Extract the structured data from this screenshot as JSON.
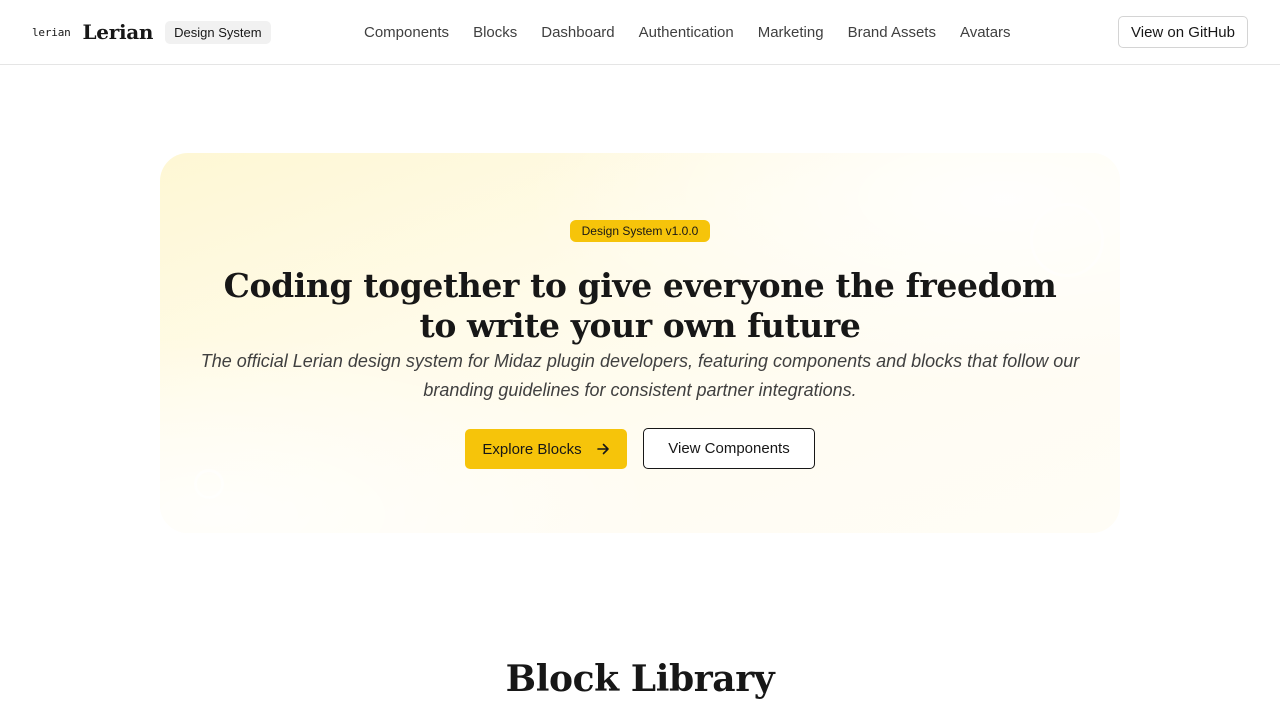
{
  "header": {
    "logo_mark": "lerian",
    "brand_name": "Lerian",
    "brand_badge": "Design System",
    "nav": [
      {
        "label": "Components"
      },
      {
        "label": "Blocks"
      },
      {
        "label": "Dashboard"
      },
      {
        "label": "Authentication"
      },
      {
        "label": "Marketing"
      },
      {
        "label": "Brand Assets"
      },
      {
        "label": "Avatars"
      }
    ],
    "github_label": "View on GitHub"
  },
  "hero": {
    "badge": "Design System v1.0.0",
    "title": "Coding together to give everyone the freedom to write your own future",
    "subtitle": "The official Lerian design system for Midaz plugin developers, featuring components and blocks that follow our branding guidelines for consistent partner integrations.",
    "primary_button": "Explore Blocks",
    "primary_icon": "arrow-right-icon",
    "secondary_button": "View Components"
  },
  "section": {
    "title": "Block Library"
  },
  "colors": {
    "accent": "#f6c40a",
    "text": "#171717",
    "muted": "#404040",
    "border": "#e5e5e5"
  }
}
